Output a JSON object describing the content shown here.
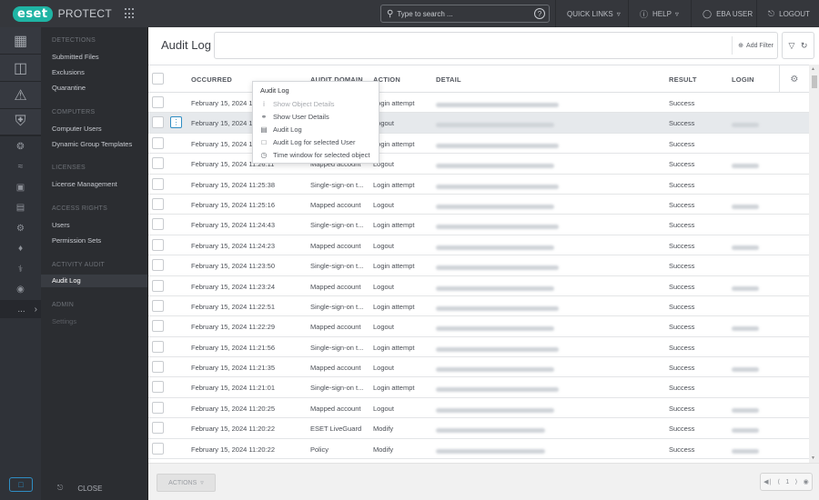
{
  "topbar": {
    "logo": "eset",
    "product": "PROTECT",
    "search_placeholder": "Type to search ...",
    "quick_links": "QUICK LINKS",
    "help": "HELP",
    "user": "EBA USER",
    "logout": "LOGOUT"
  },
  "icon_sidebar": {
    "big_icons": [
      "dashboard-icon",
      "computers-icon",
      "detections-icon",
      "protections-icon"
    ],
    "small_icons": [
      "status-icon",
      "reports-icon",
      "tasks-icon",
      "installers-icon",
      "policies-icon",
      "notifications-icon",
      "status-overview-icon",
      "more-icon"
    ],
    "more_label": "..."
  },
  "menu": {
    "sections": [
      {
        "header": "DETECTIONS",
        "items": [
          "Submitted Files",
          "Exclusions",
          "Quarantine"
        ]
      },
      {
        "header": "COMPUTERS",
        "items": [
          "Computer Users",
          "Dynamic Group Templates"
        ]
      },
      {
        "header": "LICENSES",
        "items": [
          "License Management"
        ]
      },
      {
        "header": "ACCESS RIGHTS",
        "items": [
          "Users",
          "Permission Sets"
        ]
      },
      {
        "header": "ACTIVITY AUDIT",
        "items": [
          "Audit Log"
        ]
      },
      {
        "header": "ADMIN",
        "items": [
          "Settings"
        ]
      }
    ],
    "active_item": "Audit Log",
    "close_label": "CLOSE"
  },
  "main": {
    "title": "Audit Log",
    "add_filter": "Add Filter",
    "columns": [
      "OCCURRED",
      "AUDIT DOMAIN",
      "ACTION",
      "DETAIL",
      "RESULT",
      "LOGIN"
    ],
    "rows": [
      {
        "occurred": "February 15, 2024 11:",
        "domain": "",
        "action": "Login attempt",
        "result": "Success",
        "login": false
      },
      {
        "occurred": "February 15, 2024 1",
        "domain": "",
        "action": "Logout",
        "result": "Success",
        "login": true
      },
      {
        "occurred": "February 15, 2024 11",
        "domain": "",
        "action": "Login attempt",
        "result": "Success",
        "login": false
      },
      {
        "occurred": "February 15, 2024 11:26:11",
        "domain": "Mapped account",
        "action": "Logout",
        "result": "Success",
        "login": true
      },
      {
        "occurred": "February 15, 2024 11:25:38",
        "domain": "Single-sign-on t...",
        "action": "Login attempt",
        "result": "Success",
        "login": false
      },
      {
        "occurred": "February 15, 2024 11:25:16",
        "domain": "Mapped account",
        "action": "Logout",
        "result": "Success",
        "login": true
      },
      {
        "occurred": "February 15, 2024 11:24:43",
        "domain": "Single-sign-on t...",
        "action": "Login attempt",
        "result": "Success",
        "login": false
      },
      {
        "occurred": "February 15, 2024 11:24:23",
        "domain": "Mapped account",
        "action": "Logout",
        "result": "Success",
        "login": true
      },
      {
        "occurred": "February 15, 2024 11:23:50",
        "domain": "Single-sign-on t...",
        "action": "Login attempt",
        "result": "Success",
        "login": false
      },
      {
        "occurred": "February 15, 2024 11:23:24",
        "domain": "Mapped account",
        "action": "Logout",
        "result": "Success",
        "login": true
      },
      {
        "occurred": "February 15, 2024 11:22:51",
        "domain": "Single-sign-on t...",
        "action": "Login attempt",
        "result": "Success",
        "login": false
      },
      {
        "occurred": "February 15, 2024 11:22:29",
        "domain": "Mapped account",
        "action": "Logout",
        "result": "Success",
        "login": true
      },
      {
        "occurred": "February 15, 2024 11:21:56",
        "domain": "Single-sign-on t...",
        "action": "Login attempt",
        "result": "Success",
        "login": false
      },
      {
        "occurred": "February 15, 2024 11:21:35",
        "domain": "Mapped account",
        "action": "Logout",
        "result": "Success",
        "login": true
      },
      {
        "occurred": "February 15, 2024 11:21:01",
        "domain": "Single-sign-on t...",
        "action": "Login attempt",
        "result": "Success",
        "login": false
      },
      {
        "occurred": "February 15, 2024 11:20:25",
        "domain": "Mapped account",
        "action": "Logout",
        "result": "Success",
        "login": true
      },
      {
        "occurred": "February 15, 2024 11:20:22",
        "domain": "ESET LiveGuard",
        "action": "Modify",
        "result": "Success",
        "login": true
      },
      {
        "occurred": "February 15, 2024 11:20:22",
        "domain": "Policy",
        "action": "Modify",
        "result": "Success",
        "login": true
      }
    ],
    "highlighted_row": 1,
    "actions_label": "ACTIONS",
    "page_number": "1"
  },
  "context_menu": {
    "title": "Audit Log",
    "items": [
      {
        "label": "Show Object Details",
        "icon": "info-icon",
        "disabled": true
      },
      {
        "label": "Show User Details",
        "icon": "user-icon",
        "disabled": false
      },
      {
        "label": "Audit Log",
        "icon": "clipboard-icon",
        "disabled": false
      },
      {
        "label": "Audit Log for selected User",
        "icon": "user-log-icon",
        "disabled": false
      },
      {
        "label": "Time window for selected object",
        "icon": "clock-icon",
        "disabled": false
      }
    ]
  },
  "colors": {
    "brand": "#1fb4a4",
    "accent": "#2f8dc3",
    "topbar": "#35373c",
    "menu": "#2b2d31"
  }
}
